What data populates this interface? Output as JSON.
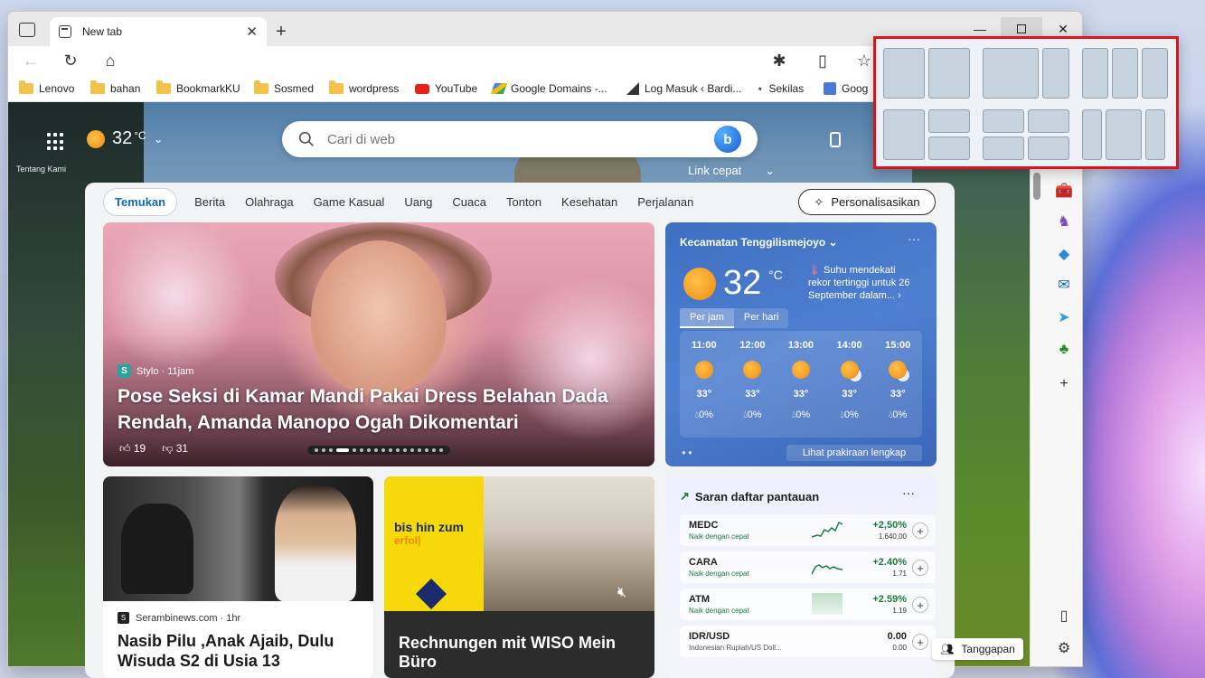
{
  "browser": {
    "tab_title": "New tab",
    "address_value": "",
    "favorites": [
      {
        "label": "Lenovo",
        "icon": "folder-icon"
      },
      {
        "label": "bahan",
        "icon": "folder-icon"
      },
      {
        "label": "BookmarkKU",
        "icon": "folder-icon"
      },
      {
        "label": "Sosmed",
        "icon": "folder-icon"
      },
      {
        "label": "wordpress",
        "icon": "folder-icon"
      },
      {
        "label": "YouTube",
        "icon": "youtube-icon"
      },
      {
        "label": "Google Domains -...",
        "icon": "google-domains-icon"
      },
      {
        "label": "Log Masuk ‹ Bardi...",
        "icon": "bardi-icon"
      },
      {
        "label": "Sekilas",
        "icon": "sekilas-icon"
      },
      {
        "label": "Goog",
        "icon": "google-icon"
      }
    ]
  },
  "newtab": {
    "temperature": "32",
    "temp_unit": "°C",
    "about_label": "Tentang Kami",
    "search_placeholder": "Cari di web",
    "quick_links_label": "Link cepat",
    "categories": [
      "Temukan",
      "Berita",
      "Olahraga",
      "Game Kasual",
      "Uang",
      "Cuaca",
      "Tonton",
      "Kesehatan",
      "Perjalanan"
    ],
    "personalize_label": "Personalisasikan",
    "feedback_label": "Tanggapan"
  },
  "hero": {
    "source": "Stylo · 11jam",
    "title": "Pose Seksi di Kamar Mandi Pakai Dress Belahan Dada Rendah, Amanda Manopo Ogah Dikomentari",
    "likes": "19",
    "dislikes": "31"
  },
  "weather": {
    "location": "Kecamatan Tenggilismejoyo",
    "temp": "32",
    "unit": "°C",
    "note": "Suhu mendekati rekor tertinggi untuk 26 September dalam...",
    "tab_hourly": "Per jam",
    "tab_daily": "Per hari",
    "hours": [
      {
        "time": "11:00",
        "temp": "33°",
        "rain": "0%",
        "icon": "sun-icon"
      },
      {
        "time": "12:00",
        "temp": "33°",
        "rain": "0%",
        "icon": "sun-icon"
      },
      {
        "time": "13:00",
        "temp": "33°",
        "rain": "0%",
        "icon": "sun-icon"
      },
      {
        "time": "14:00",
        "temp": "33°",
        "rain": "0%",
        "icon": "partly-cloudy-icon"
      },
      {
        "time": "15:00",
        "temp": "33°",
        "rain": "0%",
        "icon": "partly-cloudy-icon"
      }
    ],
    "full_forecast": "Lihat prakiraan lengkap"
  },
  "articles": [
    {
      "source": "Serambinews.com · 1hr",
      "title": "Nasib Pilu ,Anak Ajaib, Dulu Wisuda S2 di Usia 13"
    },
    {
      "promo_line1": "bis hin zum",
      "promo_line2": "erfol|",
      "title": "Rechnungen mit WISO Mein Büro"
    }
  ],
  "watchlist": {
    "title": "Saran daftar pantauan",
    "items": [
      {
        "symbol": "MEDC",
        "desc": "Naik dengan cepat",
        "pct": "+2,50%",
        "value": "1.640,00"
      },
      {
        "symbol": "CARA",
        "desc": "Naik dengan cepat",
        "pct": "+2.40%",
        "value": "1.71"
      },
      {
        "symbol": "ATM",
        "desc": "Naik dengan cepat",
        "pct": "+2.59%",
        "value": "1.19"
      },
      {
        "symbol": "IDR/USD",
        "desc": "Indonesian Rupiah/US Doll...",
        "pct": "0.00",
        "value": "0.00"
      }
    ]
  },
  "colors": {
    "accent": "#0f6cbd",
    "snap_highlight": "#d9141b",
    "up": "#1a7b3a"
  }
}
